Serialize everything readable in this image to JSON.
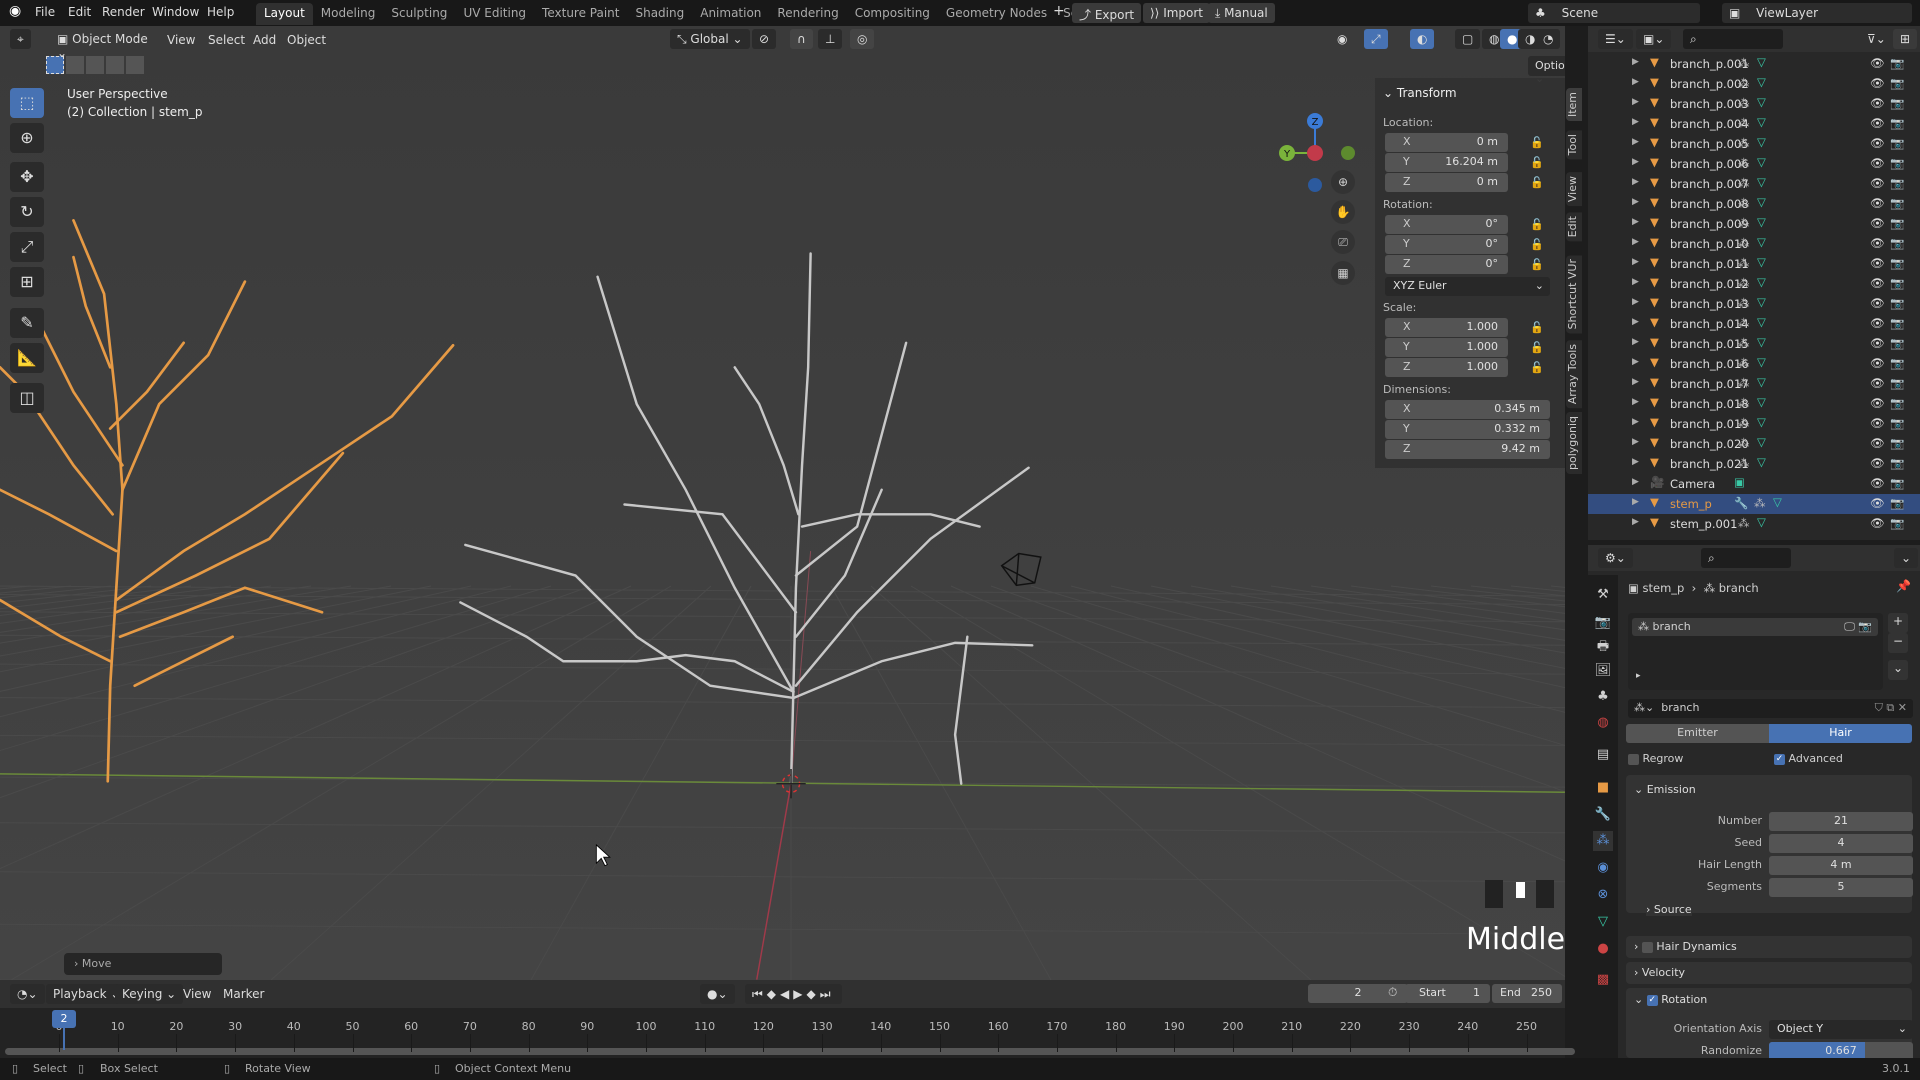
{
  "topbar": {
    "menus": [
      "File",
      "Edit",
      "Render",
      "Window",
      "Help"
    ],
    "workspaces": [
      "Layout",
      "Modeling",
      "Sculpting",
      "UV Editing",
      "Texture Paint",
      "Shading",
      "Animation",
      "Rendering",
      "Compositing",
      "Geometry Nodes",
      "Scripting"
    ],
    "active_workspace": "Layout",
    "export": "Export",
    "import": "Import",
    "manual": "Manual",
    "scene": "Scene",
    "view_layer": "ViewLayer"
  },
  "viewport_header": {
    "mode": "Object Mode",
    "menus": [
      "View",
      "Select",
      "Add",
      "Object"
    ],
    "orientation": "Global",
    "options": "Options"
  },
  "viewport": {
    "perspective": "User Perspective",
    "collection": "(2) Collection | stem_p",
    "move_panel": "Move",
    "overlay_text": "Middle",
    "gizmo": {
      "x": "X",
      "y": "Y",
      "z": "Z"
    }
  },
  "npanel": {
    "title": "Transform",
    "location_label": "Location:",
    "location": {
      "x": "0 m",
      "y": "16.204 m",
      "z": "0 m"
    },
    "rotation_label": "Rotation:",
    "rotation": {
      "x": "0°",
      "y": "0°",
      "z": "0°"
    },
    "rotation_mode": "XYZ Euler",
    "scale_label": "Scale:",
    "scale": {
      "x": "1.000",
      "y": "1.000",
      "z": "1.000"
    },
    "dimensions_label": "Dimensions:",
    "dimensions": {
      "x": "0.345 m",
      "y": "0.332 m",
      "z": "9.42 m"
    },
    "axis": {
      "x": "X",
      "y": "Y",
      "z": "Z"
    },
    "tabs": [
      "Item",
      "Tool",
      "View",
      "Edit",
      "Shortcut VUr",
      "Array Tools",
      "polygoniq"
    ]
  },
  "outliner": {
    "items": [
      "branch_p.001",
      "branch_p.002",
      "branch_p.003",
      "branch_p.004",
      "branch_p.005",
      "branch_p.006",
      "branch_p.007",
      "branch_p.008",
      "branch_p.009",
      "branch_p.010",
      "branch_p.011",
      "branch_p.012",
      "branch_p.013",
      "branch_p.014",
      "branch_p.015",
      "branch_p.016",
      "branch_p.017",
      "branch_p.018",
      "branch_p.019",
      "branch_p.020",
      "branch_p.021",
      "Camera",
      "stem_p",
      "stem_p.001"
    ],
    "selected": "stem_p"
  },
  "properties": {
    "breadcrumb_object": "stem_p",
    "breadcrumb_system": "branch",
    "list_item": "branch",
    "settings_name": "branch",
    "type_emitter": "Emitter",
    "type_hair": "Hair",
    "active_type": "Hair",
    "regrow": "Regrow",
    "regrow_checked": false,
    "advanced": "Advanced",
    "advanced_checked": true,
    "emission": {
      "title": "Emission",
      "number_label": "Number",
      "number": "21",
      "seed_label": "Seed",
      "seed": "4",
      "hair_length_label": "Hair Length",
      "hair_length": "4 m",
      "segments_label": "Segments",
      "segments": "5",
      "source": "Source"
    },
    "hair_dynamics": "Hair Dynamics",
    "velocity": "Velocity",
    "rotation": {
      "title": "Rotation",
      "enabled": true,
      "orientation_axis_label": "Orientation Axis",
      "orientation_axis": "Object Y",
      "randomize_label": "Randomize",
      "randomize": "0.667",
      "randomize_fraction": 0.667
    }
  },
  "timeline": {
    "menus": [
      "Playback",
      "Keying",
      "View",
      "Marker"
    ],
    "current_frame": "2",
    "start_label": "Start",
    "start": "1",
    "end_label": "End",
    "end": "250",
    "ticks": [
      "0",
      "10",
      "20",
      "30",
      "40",
      "50",
      "60",
      "70",
      "80",
      "90",
      "100",
      "110",
      "120",
      "130",
      "140",
      "150",
      "160",
      "170",
      "180",
      "190",
      "200",
      "210",
      "220",
      "230",
      "240",
      "250"
    ]
  },
  "status": {
    "select": "Select",
    "box_select": "Box Select",
    "rotate_view": "Rotate View",
    "context_menu": "Object Context Menu",
    "version": "3.0.1"
  },
  "colors": {
    "accent": "#4772b3",
    "object_orange": "#e69a45",
    "mesh_green": "#39c9a6",
    "selected_row": "#334d80"
  }
}
